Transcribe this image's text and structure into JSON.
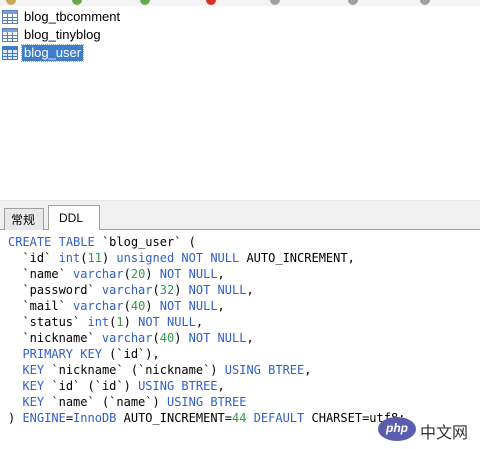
{
  "tables": [
    {
      "label": "blog_tbcomment",
      "selected": false
    },
    {
      "label": "blog_tinyblog",
      "selected": false
    },
    {
      "label": "blog_user",
      "selected": true
    }
  ],
  "tabs": [
    {
      "label": "常规",
      "active": false
    },
    {
      "label": "DDL",
      "active": true
    }
  ],
  "ddl_tokens": [
    [
      [
        "kw",
        "CREATE"
      ],
      [
        "t",
        " "
      ],
      [
        "kw",
        "TABLE"
      ],
      [
        "t",
        " `blog_user` ("
      ]
    ],
    [
      [
        "t",
        "  `id` "
      ],
      [
        "kw",
        "int"
      ],
      [
        "t",
        "("
      ],
      [
        "num",
        "11"
      ],
      [
        "t",
        ") "
      ],
      [
        "kw",
        "unsigned NOT NULL"
      ],
      [
        "t",
        " AUTO_INCREMENT,"
      ]
    ],
    [
      [
        "t",
        "  `name` "
      ],
      [
        "kw",
        "varchar"
      ],
      [
        "t",
        "("
      ],
      [
        "num",
        "20"
      ],
      [
        "t",
        ") "
      ],
      [
        "kw",
        "NOT NULL"
      ],
      [
        "t",
        ","
      ]
    ],
    [
      [
        "t",
        "  `password` "
      ],
      [
        "kw",
        "varchar"
      ],
      [
        "t",
        "("
      ],
      [
        "num",
        "32"
      ],
      [
        "t",
        ") "
      ],
      [
        "kw",
        "NOT NULL"
      ],
      [
        "t",
        ","
      ]
    ],
    [
      [
        "t",
        "  `mail` "
      ],
      [
        "kw",
        "varchar"
      ],
      [
        "t",
        "("
      ],
      [
        "num",
        "40"
      ],
      [
        "t",
        ") "
      ],
      [
        "kw",
        "NOT NULL"
      ],
      [
        "t",
        ","
      ]
    ],
    [
      [
        "t",
        "  `status` "
      ],
      [
        "kw",
        "int"
      ],
      [
        "t",
        "("
      ],
      [
        "num",
        "1"
      ],
      [
        "t",
        ") "
      ],
      [
        "kw",
        "NOT NULL"
      ],
      [
        "t",
        ","
      ]
    ],
    [
      [
        "t",
        "  `nickname` "
      ],
      [
        "kw",
        "varchar"
      ],
      [
        "t",
        "("
      ],
      [
        "num",
        "40"
      ],
      [
        "t",
        ") "
      ],
      [
        "kw",
        "NOT NULL"
      ],
      [
        "t",
        ","
      ]
    ],
    [
      [
        "t",
        "  "
      ],
      [
        "kw",
        "PRIMARY KEY"
      ],
      [
        "t",
        " (`id`),"
      ]
    ],
    [
      [
        "t",
        "  "
      ],
      [
        "kw",
        "KEY"
      ],
      [
        "t",
        " `nickname` (`nickname`) "
      ],
      [
        "kw",
        "USING BTREE"
      ],
      [
        "t",
        ","
      ]
    ],
    [
      [
        "t",
        "  "
      ],
      [
        "kw",
        "KEY"
      ],
      [
        "t",
        " `id` (`id`) "
      ],
      [
        "kw",
        "USING BTREE"
      ],
      [
        "t",
        ","
      ]
    ],
    [
      [
        "t",
        "  "
      ],
      [
        "kw",
        "KEY"
      ],
      [
        "t",
        " `name` (`name`) "
      ],
      [
        "kw",
        "USING BTREE"
      ]
    ],
    [
      [
        "t",
        ") "
      ],
      [
        "kw",
        "ENGINE"
      ],
      [
        "t",
        "="
      ],
      [
        "kw",
        "InnoDB"
      ],
      [
        "t",
        " AUTO_INCREMENT="
      ],
      [
        "num",
        "44"
      ],
      [
        "t",
        " "
      ],
      [
        "kw",
        "DEFAULT"
      ],
      [
        "t",
        " CHARSET=utf8;"
      ]
    ]
  ],
  "watermark": {
    "logo": "php",
    "text": "中文网"
  },
  "colors": {
    "keyword": "#3060c8",
    "number": "#2e9a4a",
    "selection": "#3f7dc8"
  }
}
